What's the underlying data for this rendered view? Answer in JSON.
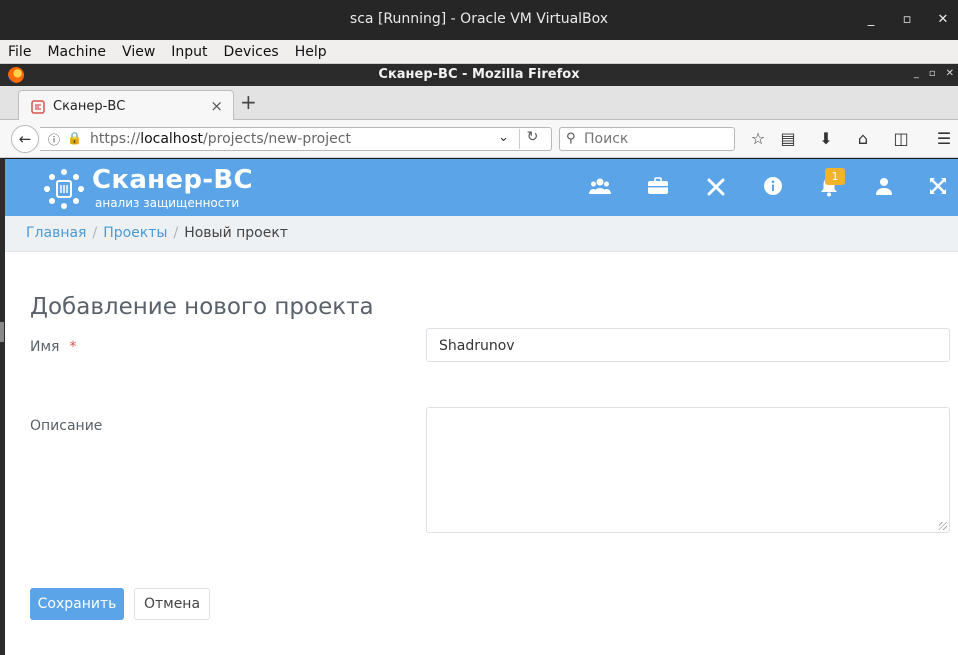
{
  "vbox": {
    "title": "sca [Running] - Oracle VM VirtualBox",
    "menu": [
      "File",
      "Machine",
      "View",
      "Input",
      "Devices",
      "Help"
    ],
    "controls": {
      "minimize": "_",
      "maximize": "▫",
      "close": "✕"
    }
  },
  "firefox": {
    "title": "Сканер-ВС - Mozilla Firefox",
    "tab_label": "Сканер-ВС",
    "new_tab": "+",
    "url": {
      "prefix": "https://",
      "host": "localhost",
      "path": "/projects/new-project"
    },
    "search_placeholder": "Поиск"
  },
  "app": {
    "logo_title": "Сканер-ВС",
    "logo_subtitle": "анализ защищенности",
    "notifications_count": "1"
  },
  "breadcrumb": {
    "home": "Главная",
    "projects": "Проекты",
    "current": "Новый проект",
    "separator": "/"
  },
  "form": {
    "title": "Добавление нового проекта",
    "name_label": "Имя",
    "required_mark": "*",
    "name_value": "Shadrunov",
    "description_label": "Описание",
    "description_value": "",
    "save_label": "Сохранить",
    "cancel_label": "Отмена"
  },
  "colors": {
    "header": "#5ba4e8",
    "link": "#4a9ad8",
    "badge": "#f0b429",
    "required": "#d9534f"
  }
}
